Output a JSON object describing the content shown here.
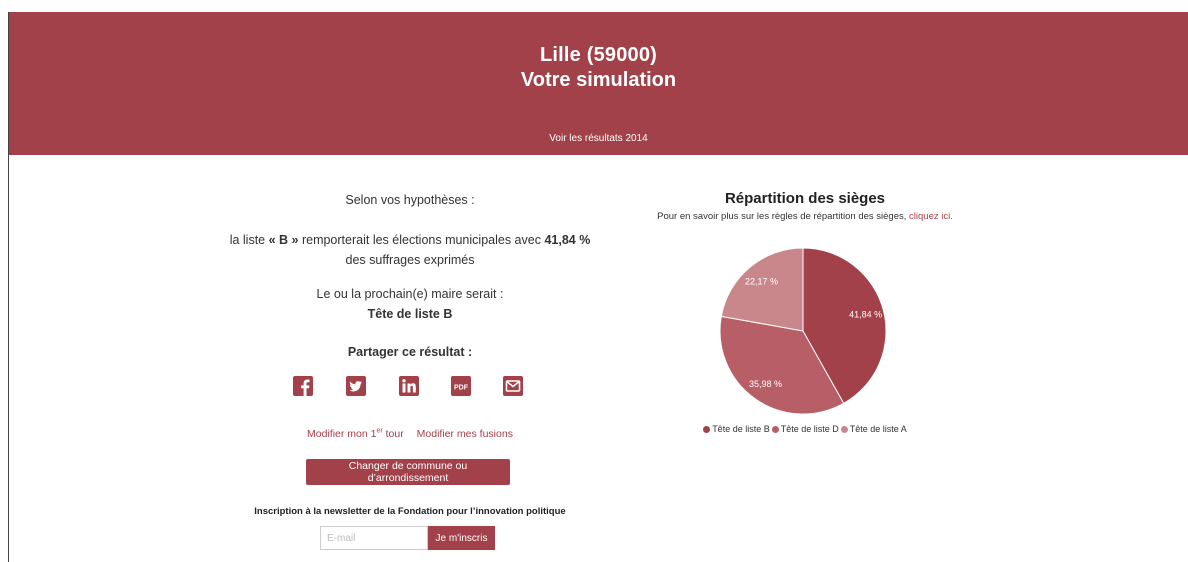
{
  "header": {
    "city": "Lille (59000)",
    "subtitle": "Votre simulation",
    "results_link": "Voir les résultats 2014"
  },
  "summary": {
    "hypotheses": "Selon vos hypothèses :",
    "result_prefix": "la liste ",
    "winner_list": "« B »",
    "result_middle": " remporterait les élections municipales avec ",
    "winner_pct": "41,84 %",
    "result_suffix": " des suffrages exprimés",
    "mayor_line": "Le ou la prochain(e) maire serait :",
    "mayor_name": "Tête de liste B"
  },
  "share": {
    "title": "Partager ce résultat :",
    "icons": [
      "facebook-icon",
      "twitter-icon",
      "linkedin-icon",
      "pdf-icon",
      "email-icon"
    ],
    "pdf_text": "PDF"
  },
  "links": {
    "modify_first_base": "Modifier mon 1",
    "modify_first_sup": "er",
    "modify_first_end": " tour",
    "modify_fusions": "Modifier mes fusions"
  },
  "change_button": "Changer de commune ou d’arrondissement",
  "newsletter": {
    "title": "Inscription à la newsletter de la Fondation pour l’innovation politique",
    "placeholder": "E-mail",
    "button": "Je m'inscris"
  },
  "chart_data": {
    "type": "pie",
    "title": "Répartition des sièges",
    "note_text": "Pour en savoir plus sur les règles de répartition des sièges, ",
    "note_link": "cliquez ici.",
    "slices": [
      {
        "name": "Tête de liste B",
        "value": 41.84,
        "label": "41,84 %",
        "color": "#a2414a"
      },
      {
        "name": "Tête de liste D",
        "value": 35.98,
        "label": "35,98 %",
        "color": "#b75e66"
      },
      {
        "name": "Tête de liste A",
        "value": 22.17,
        "label": "22,17 %",
        "color": "#c9878c"
      }
    ],
    "legend_position": "bottom"
  },
  "colors": {
    "brand": "#a2414a"
  }
}
